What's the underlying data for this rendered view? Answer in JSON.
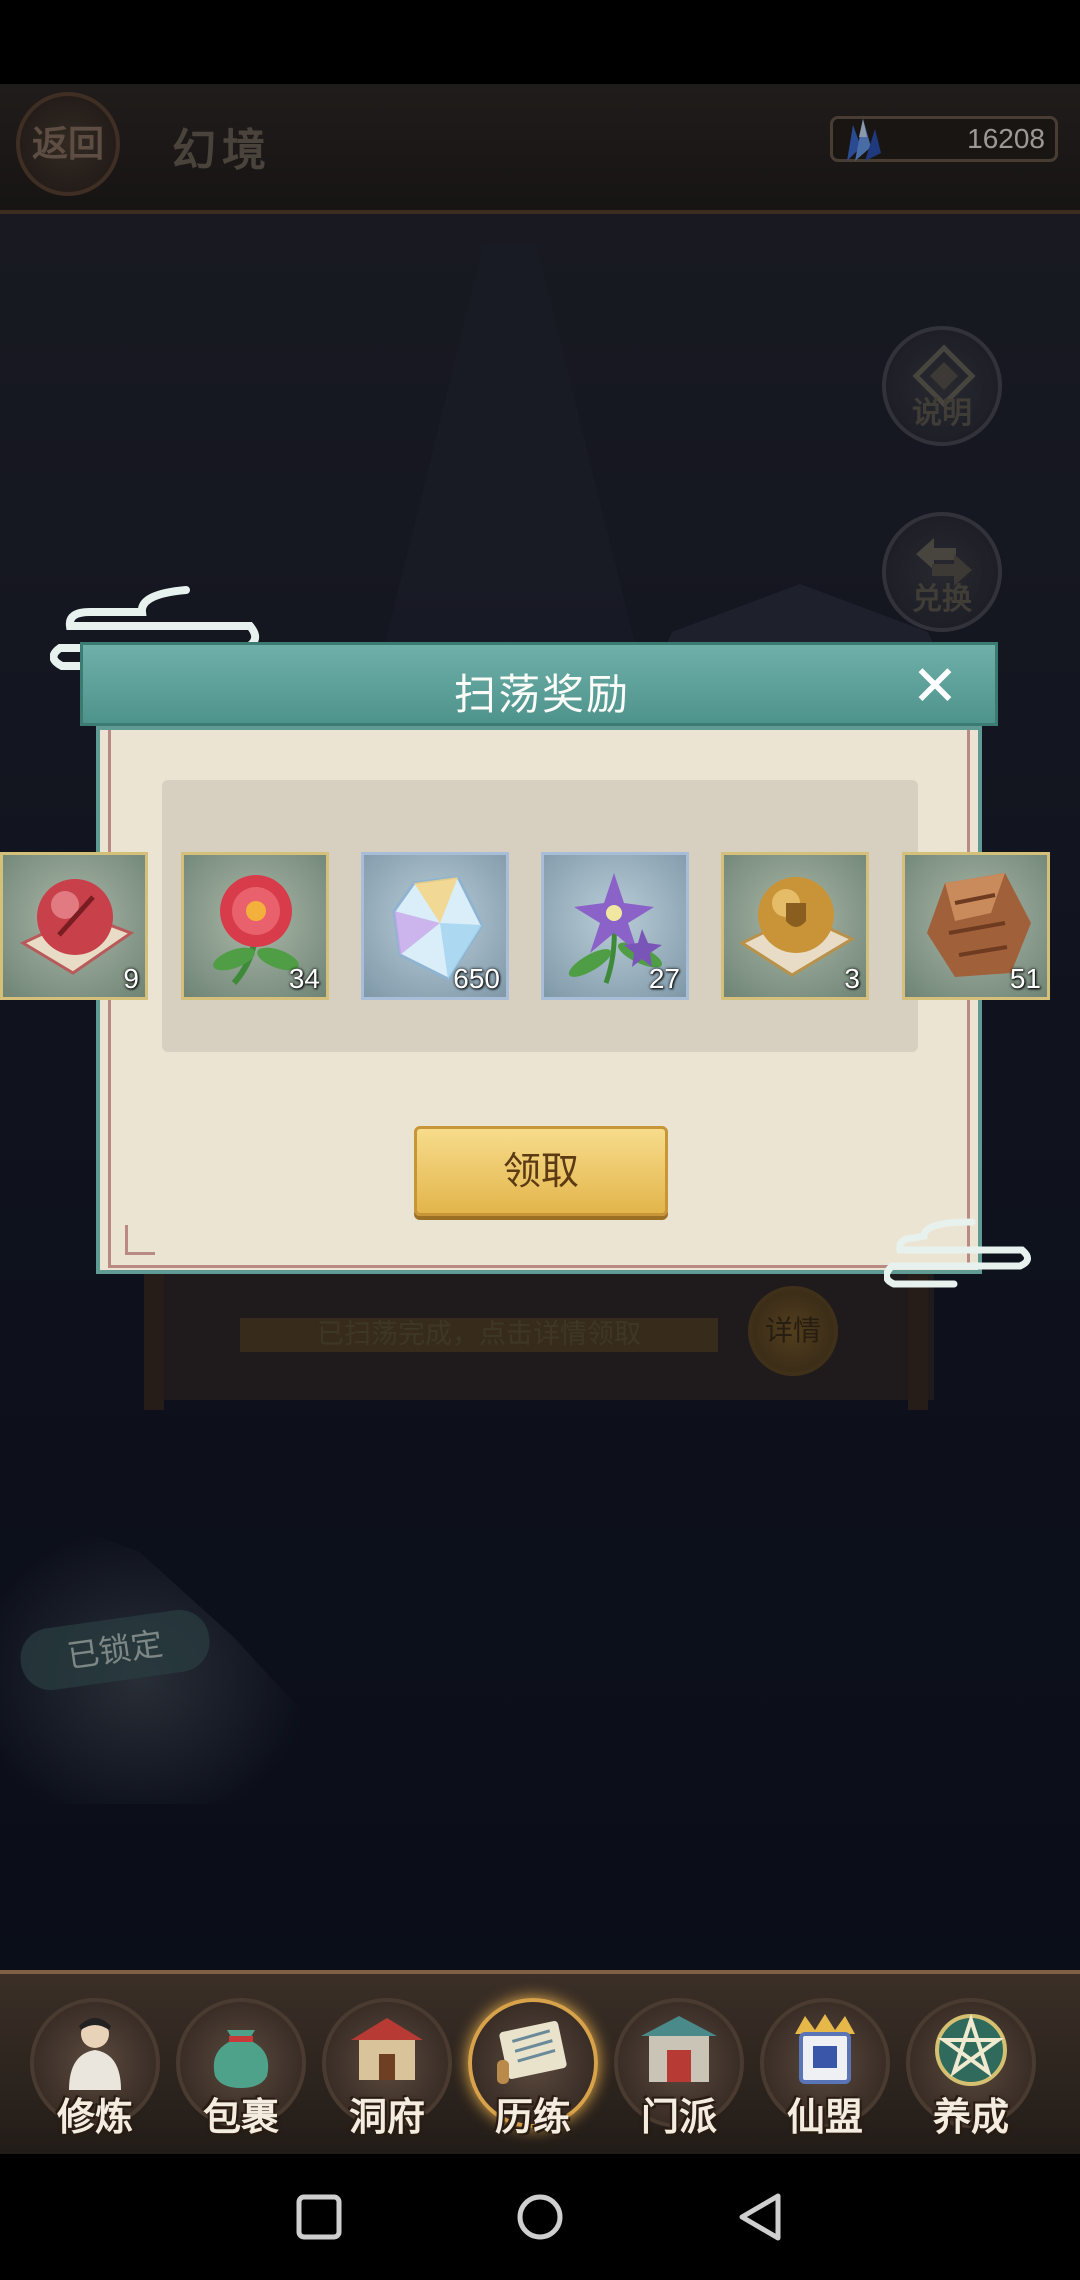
{
  "header": {
    "back_label": "返回",
    "title": "幻境",
    "currency": {
      "icon": "crystal-icon",
      "value": "16208"
    }
  },
  "side_buttons": {
    "explain_label": "说明",
    "exchange_label": "兑换"
  },
  "background": {
    "status_text": "已扫荡完成，点击详情领取",
    "details_label": "详情",
    "locked_label": "已锁定"
  },
  "dialog": {
    "title": "扫荡奖励",
    "close_icon": "close-icon",
    "rewards": [
      {
        "icon": "red-orb-icon",
        "qty": "9"
      },
      {
        "icon": "red-flower-icon",
        "qty": "34"
      },
      {
        "icon": "crystal-icon",
        "qty": "650"
      },
      {
        "icon": "purple-flower-icon",
        "qty": "27"
      },
      {
        "icon": "golden-orb-icon",
        "qty": "3"
      },
      {
        "icon": "ore-icon",
        "qty": "51"
      }
    ],
    "claim_label": "领取"
  },
  "bottom_nav": [
    {
      "label": "修炼",
      "icon": "cultivator-icon"
    },
    {
      "label": "包裹",
      "icon": "bag-icon"
    },
    {
      "label": "洞府",
      "icon": "cave-house-icon"
    },
    {
      "label": "历练",
      "icon": "scroll-icon",
      "active": true
    },
    {
      "label": "门派",
      "icon": "sect-gate-icon"
    },
    {
      "label": "仙盟",
      "icon": "alliance-icon"
    },
    {
      "label": "养成",
      "icon": "pentagram-icon"
    }
  ],
  "colors": {
    "accent_teal": "#5aa39c",
    "gold": "#e3b54b",
    "parchment": "#ece4d3"
  }
}
